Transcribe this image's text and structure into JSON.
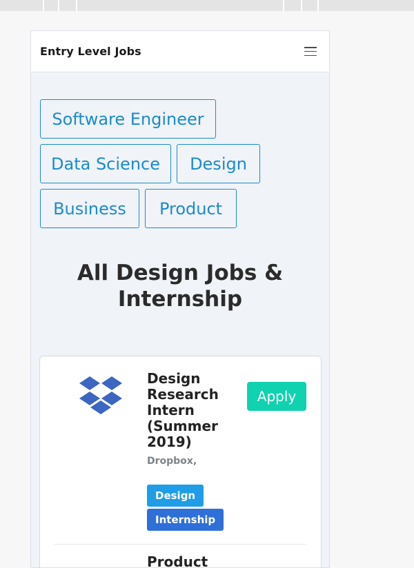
{
  "navbar": {
    "brand": "Entry Level Jobs",
    "menu_icon": "hamburger-menu-icon"
  },
  "categories": [
    {
      "label": "Software Engineer"
    },
    {
      "label": "Data Science"
    },
    {
      "label": "Design"
    },
    {
      "label": "Business"
    },
    {
      "label": "Product"
    }
  ],
  "page_title": {
    "line1": "All Design Jobs &",
    "line2": "Internship"
  },
  "jobs": [
    {
      "title_lines": [
        "Design",
        "Research",
        "Intern",
        "(Summer",
        "2019)"
      ],
      "company": "Dropbox,",
      "tags": [
        "Design",
        "Internship"
      ],
      "apply_label": "Apply",
      "logo_icon": "dropbox-logo-icon"
    },
    {
      "title_partial": "Product"
    }
  ],
  "colors": {
    "accent_blue": "#1a8bd0",
    "apply_teal": "#10d1b0",
    "tag_design": "#1f9de6",
    "tag_internship": "#2f6fd8",
    "page_bg": "#f0f3f7"
  }
}
